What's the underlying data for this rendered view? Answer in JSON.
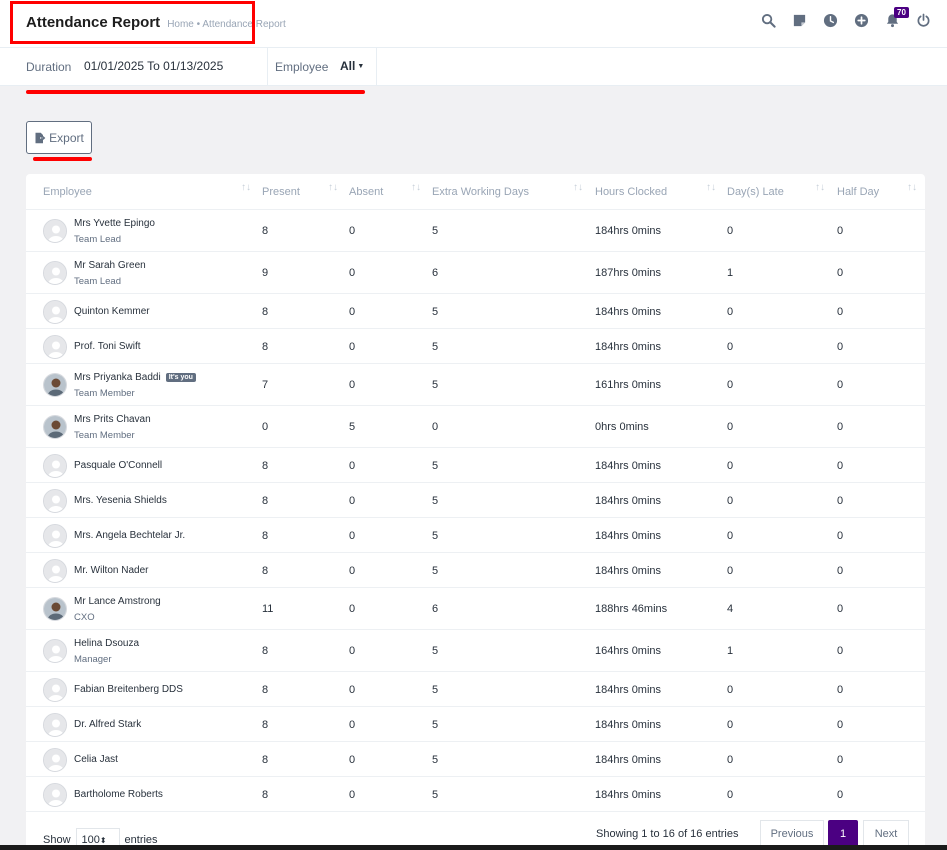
{
  "header": {
    "title": "Attendance Report",
    "breadcrumb": "Home • Attendance Report",
    "notification_count": "70",
    "icons": [
      "search-icon",
      "sticky-note-icon",
      "clock-icon",
      "plus-circle-icon",
      "bell-icon",
      "power-icon"
    ]
  },
  "filters": {
    "duration_label": "Duration",
    "duration_value": "01/01/2025 To 01/13/2025",
    "employee_label": "Employee",
    "employee_value": "All"
  },
  "toolbar": {
    "export_label": "Export"
  },
  "table": {
    "columns": [
      "Employee",
      "Present",
      "Absent",
      "Extra Working Days",
      "Hours Clocked",
      "Day(s) Late",
      "Half Day"
    ],
    "rows": [
      {
        "name": "Mrs Yvette Epingo",
        "role": "Team Lead",
        "photo": "default",
        "present": "8",
        "absent": "0",
        "extra": "5",
        "hours": "184hrs 0mins",
        "late": "0",
        "half": "0"
      },
      {
        "name": "Mr Sarah Green",
        "role": "Team Lead",
        "photo": "default",
        "present": "9",
        "absent": "0",
        "extra": "6",
        "hours": "187hrs 0mins",
        "late": "1",
        "half": "0"
      },
      {
        "name": "Quinton Kemmer",
        "role": "",
        "photo": "default",
        "present": "8",
        "absent": "0",
        "extra": "5",
        "hours": "184hrs 0mins",
        "late": "0",
        "half": "0"
      },
      {
        "name": "Prof. Toni Swift",
        "role": "",
        "photo": "default",
        "present": "8",
        "absent": "0",
        "extra": "5",
        "hours": "184hrs 0mins",
        "late": "0",
        "half": "0"
      },
      {
        "name": "Mrs Priyanka Baddi",
        "role": "Team Member",
        "photo": "photo",
        "you": "It's you",
        "present": "7",
        "absent": "0",
        "extra": "5",
        "hours": "161hrs 0mins",
        "late": "0",
        "half": "0"
      },
      {
        "name": "Mrs Prits Chavan",
        "role": "Team Member",
        "photo": "photo",
        "present": "0",
        "absent": "5",
        "extra": "0",
        "hours": "0hrs 0mins",
        "late": "0",
        "half": "0"
      },
      {
        "name": "Pasquale O'Connell",
        "role": "",
        "photo": "default",
        "present": "8",
        "absent": "0",
        "extra": "5",
        "hours": "184hrs 0mins",
        "late": "0",
        "half": "0"
      },
      {
        "name": "Mrs. Yesenia Shields",
        "role": "",
        "photo": "default",
        "present": "8",
        "absent": "0",
        "extra": "5",
        "hours": "184hrs 0mins",
        "late": "0",
        "half": "0"
      },
      {
        "name": "Mrs. Angela Bechtelar Jr.",
        "role": "",
        "photo": "default",
        "present": "8",
        "absent": "0",
        "extra": "5",
        "hours": "184hrs 0mins",
        "late": "0",
        "half": "0"
      },
      {
        "name": "Mr. Wilton Nader",
        "role": "",
        "photo": "default",
        "present": "8",
        "absent": "0",
        "extra": "5",
        "hours": "184hrs 0mins",
        "late": "0",
        "half": "0"
      },
      {
        "name": "Mr Lance Amstrong",
        "role": "CXO",
        "photo": "photo",
        "present": "11",
        "absent": "0",
        "extra": "6",
        "hours": "188hrs 46mins",
        "late": "4",
        "half": "0"
      },
      {
        "name": "Helina Dsouza",
        "role": "Manager",
        "photo": "default",
        "present": "8",
        "absent": "0",
        "extra": "5",
        "hours": "164hrs 0mins",
        "late": "1",
        "half": "0"
      },
      {
        "name": "Fabian Breitenberg DDS",
        "role": "",
        "photo": "default",
        "present": "8",
        "absent": "0",
        "extra": "5",
        "hours": "184hrs 0mins",
        "late": "0",
        "half": "0"
      },
      {
        "name": "Dr. Alfred Stark",
        "role": "",
        "photo": "default",
        "present": "8",
        "absent": "0",
        "extra": "5",
        "hours": "184hrs 0mins",
        "late": "0",
        "half": "0"
      },
      {
        "name": "Celia Jast",
        "role": "",
        "photo": "default",
        "present": "8",
        "absent": "0",
        "extra": "5",
        "hours": "184hrs 0mins",
        "late": "0",
        "half": "0"
      },
      {
        "name": "Bartholome Roberts",
        "role": "",
        "photo": "default",
        "present": "8",
        "absent": "0",
        "extra": "5",
        "hours": "184hrs 0mins",
        "late": "0",
        "half": "0"
      }
    ]
  },
  "footer": {
    "show_label": "Show",
    "page_size": "100",
    "entries_label": "entries",
    "showing_text": "Showing 1 to 16 of 16 entries",
    "previous_label": "Previous",
    "current_page": "1",
    "next_label": "Next"
  },
  "colors": {
    "accent": "#4b0082",
    "annotation": "#ff0000"
  }
}
